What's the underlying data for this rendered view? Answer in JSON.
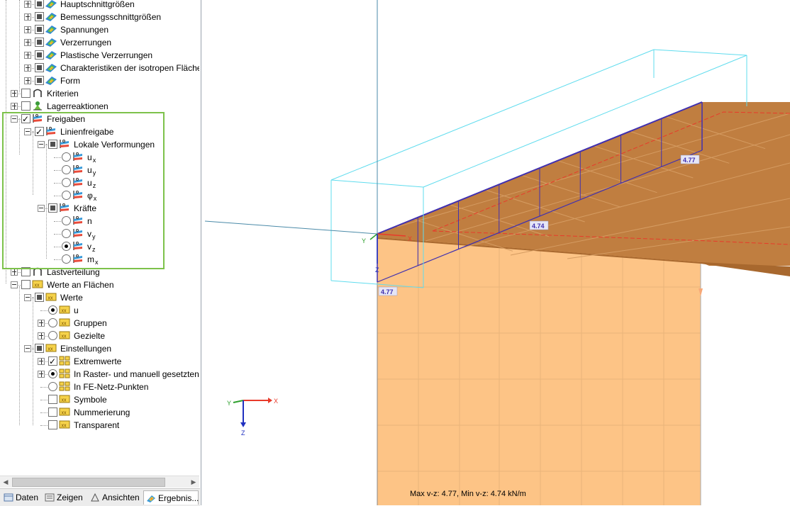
{
  "navigator": {
    "items": [
      {
        "label": "Hauptschnittgrößen"
      },
      {
        "label": "Bemessungsschnittgrößen"
      },
      {
        "label": "Spannungen"
      },
      {
        "label": "Verzerrungen"
      },
      {
        "label": "Plastische Verzerrungen"
      },
      {
        "label": "Charakteristiken der isotropen Fläche"
      },
      {
        "label": "Form"
      },
      {
        "label": "Kriterien"
      },
      {
        "label": "Lagerreaktionen"
      },
      {
        "label": "Freigaben"
      },
      {
        "label": "Linienfreigabe"
      },
      {
        "label": "Lokale Verformungen"
      },
      {
        "label": "u",
        "sub": "x"
      },
      {
        "label": "u",
        "sub": "y"
      },
      {
        "label": "u",
        "sub": "z"
      },
      {
        "label": "φ",
        "sub": "x"
      },
      {
        "label": "Kräfte"
      },
      {
        "label": "n"
      },
      {
        "label": "v",
        "sub": "y"
      },
      {
        "label": "v",
        "sub": "z"
      },
      {
        "label": "m",
        "sub": "x"
      },
      {
        "label": "Lastverteilung"
      },
      {
        "label": "Werte an Flächen"
      },
      {
        "label": "Werte"
      },
      {
        "label": "u"
      },
      {
        "label": "Gruppen"
      },
      {
        "label": "Gezielte"
      },
      {
        "label": "Einstellungen"
      },
      {
        "label": "Extremwerte"
      },
      {
        "label": "In Raster- und manuell gesetzten P"
      },
      {
        "label": "In FE-Netz-Punkten"
      },
      {
        "label": "Symbole"
      },
      {
        "label": "Nummerierung"
      },
      {
        "label": "Transparent"
      }
    ]
  },
  "tabs": [
    {
      "label": "Daten"
    },
    {
      "label": "Zeigen"
    },
    {
      "label": "Ansichten"
    },
    {
      "label": "Ergebnis..."
    }
  ],
  "viewport": {
    "value_labels": [
      "4.77",
      "4.74",
      "4.77"
    ],
    "axes": {
      "x": "X",
      "y": "Y",
      "z": "Z"
    },
    "status": "Max v-z: 4.77, Min v-z: 4.74 kN/m"
  },
  "colors": {
    "highlight_frame": "#7dc24b",
    "slab": "#c07e40",
    "wall": "#fdc486",
    "release_line": "#4030b0",
    "box_outline": "#5fdcee"
  }
}
